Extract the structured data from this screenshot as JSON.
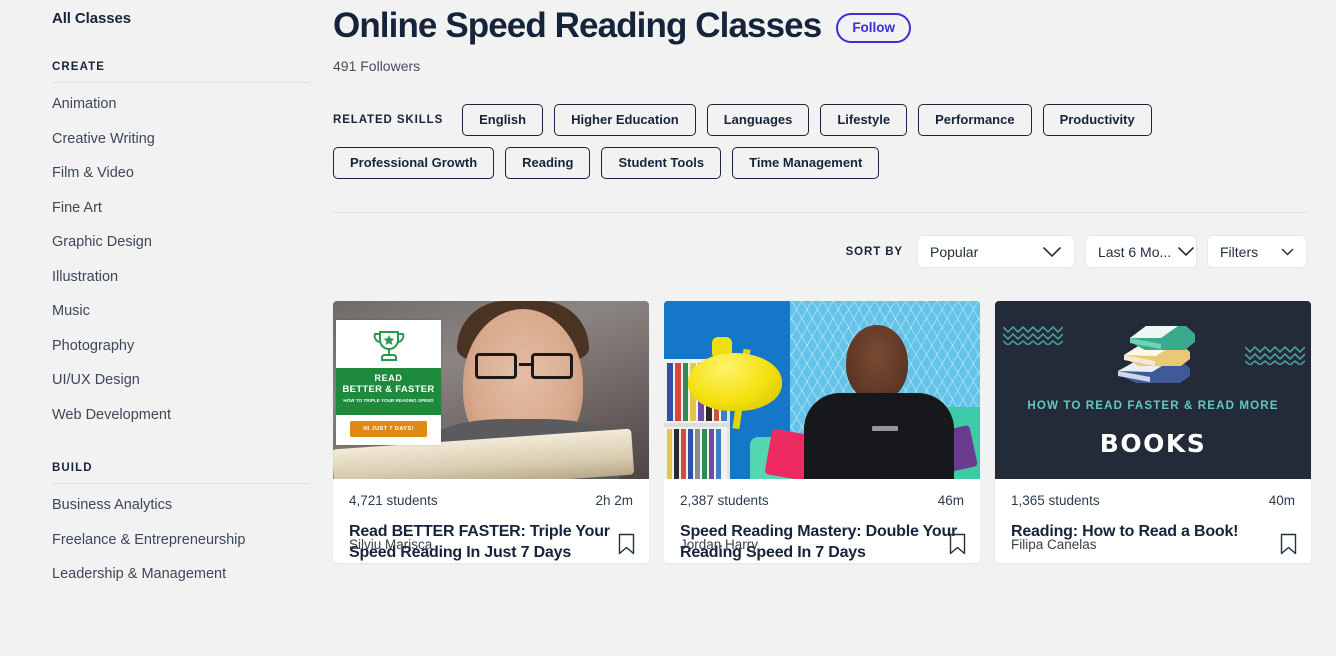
{
  "sidebar": {
    "all_classes": "All Classes",
    "groups": [
      {
        "title": "CREATE",
        "items": [
          "Animation",
          "Creative Writing",
          "Film & Video",
          "Fine Art",
          "Graphic Design",
          "Illustration",
          "Music",
          "Photography",
          "UI/UX Design",
          "Web Development"
        ]
      },
      {
        "title": "BUILD",
        "items": [
          "Business Analytics",
          "Freelance & Entrepreneurship",
          "Leadership & Management"
        ]
      }
    ]
  },
  "header": {
    "title": "Online Speed Reading Classes",
    "follow_label": "Follow",
    "followers": "491 Followers"
  },
  "skills": {
    "label": "RELATED SKILLS",
    "row1": [
      "English",
      "Higher Education",
      "Languages",
      "Lifestyle",
      "Performance",
      "Productivity"
    ],
    "row2": [
      "Professional Growth",
      "Reading",
      "Student Tools",
      "Time Management"
    ]
  },
  "sortbar": {
    "sort_by_label": "SORT BY",
    "sort_value": "Popular",
    "recency_value": "Last 6 Mo...",
    "filters_label": "Filters"
  },
  "colors": {
    "page_background": "#f2f2f2",
    "text_primary": "#16243b",
    "accent_follow": "#3c2fd4",
    "card_background": "#ffffff",
    "divider": "#e2e2e2"
  },
  "cards": [
    {
      "students": "4,721 students",
      "duration": "2h 2m",
      "title": "Read BETTER FASTER: Triple Your Speed Reading In Just 7 Days",
      "teacher": "Silviu Marisca",
      "thumb": {
        "kind": "photo-woman-reading-with-overlay",
        "overlay_line1": "READ",
        "overlay_line2": "BETTER & FASTER",
        "overlay_line3": "HOW TO TRIPLE YOUR READING SPEED",
        "overlay_badge": "IN JUST 7 DAYS!",
        "band_color": "#1e8a3c",
        "badge_color": "#e08a15"
      }
    },
    {
      "students": "2,387 students",
      "duration": "46m",
      "title": "Speed Reading Mastery: Double Your Reading Speed In 7 Days",
      "teacher": "Jordan Harry",
      "thumb": {
        "kind": "photo-man-blue-room-yellow-lamp",
        "wall_color": "#1577c7",
        "lamp_color": "#f3e10e"
      }
    },
    {
      "students": "1,365 students",
      "duration": "40m",
      "title": "Reading: How to Read a Book!",
      "teacher": "Filipa Canelas",
      "thumb": {
        "kind": "graphic-book-stack-dark",
        "line1": "HOW TO READ FASTER & READ MORE",
        "line2": "BOOKS",
        "bg_color": "#232b38",
        "accent_color": "#5fc9c2"
      }
    }
  ],
  "icons": {
    "bookmark": "bookmark-icon",
    "chevron_down": "chevron-down-icon",
    "trophy": "trophy-icon"
  }
}
